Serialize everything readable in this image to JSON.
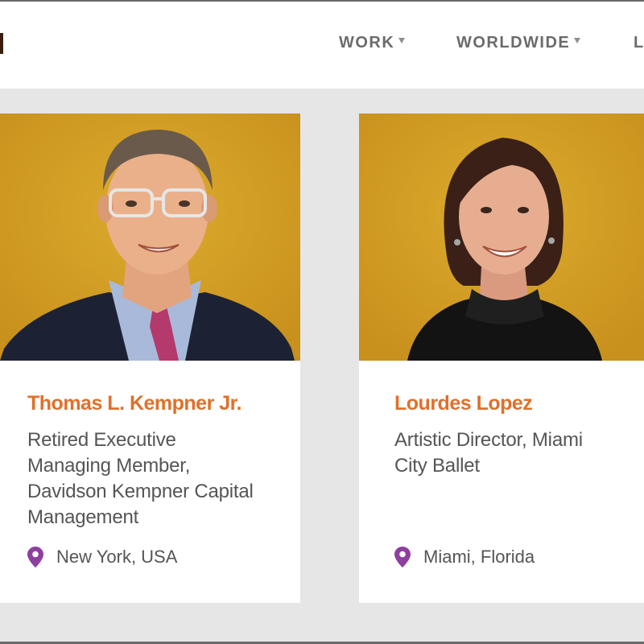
{
  "nav": {
    "items": [
      {
        "label": "WORK"
      },
      {
        "label": "WORLDWIDE"
      },
      {
        "label": "L"
      }
    ]
  },
  "colors": {
    "name_accent": "#e0702a",
    "pin": "#8e3fa0",
    "photo_background": "#d6a126"
  },
  "people": [
    {
      "name": "Thomas L. Kempner Jr.",
      "title_lines": [
        "Retired Executive",
        "Managing Member,",
        "Davidson Kempner Capital",
        "Management"
      ],
      "location": "New York, USA",
      "photo_icon": "portrait-photo"
    },
    {
      "name": "Lourdes Lopez",
      "title_lines": [
        "Artistic Director, Miami",
        "City Ballet"
      ],
      "location": "Miami, Florida",
      "photo_icon": "portrait-photo"
    }
  ]
}
